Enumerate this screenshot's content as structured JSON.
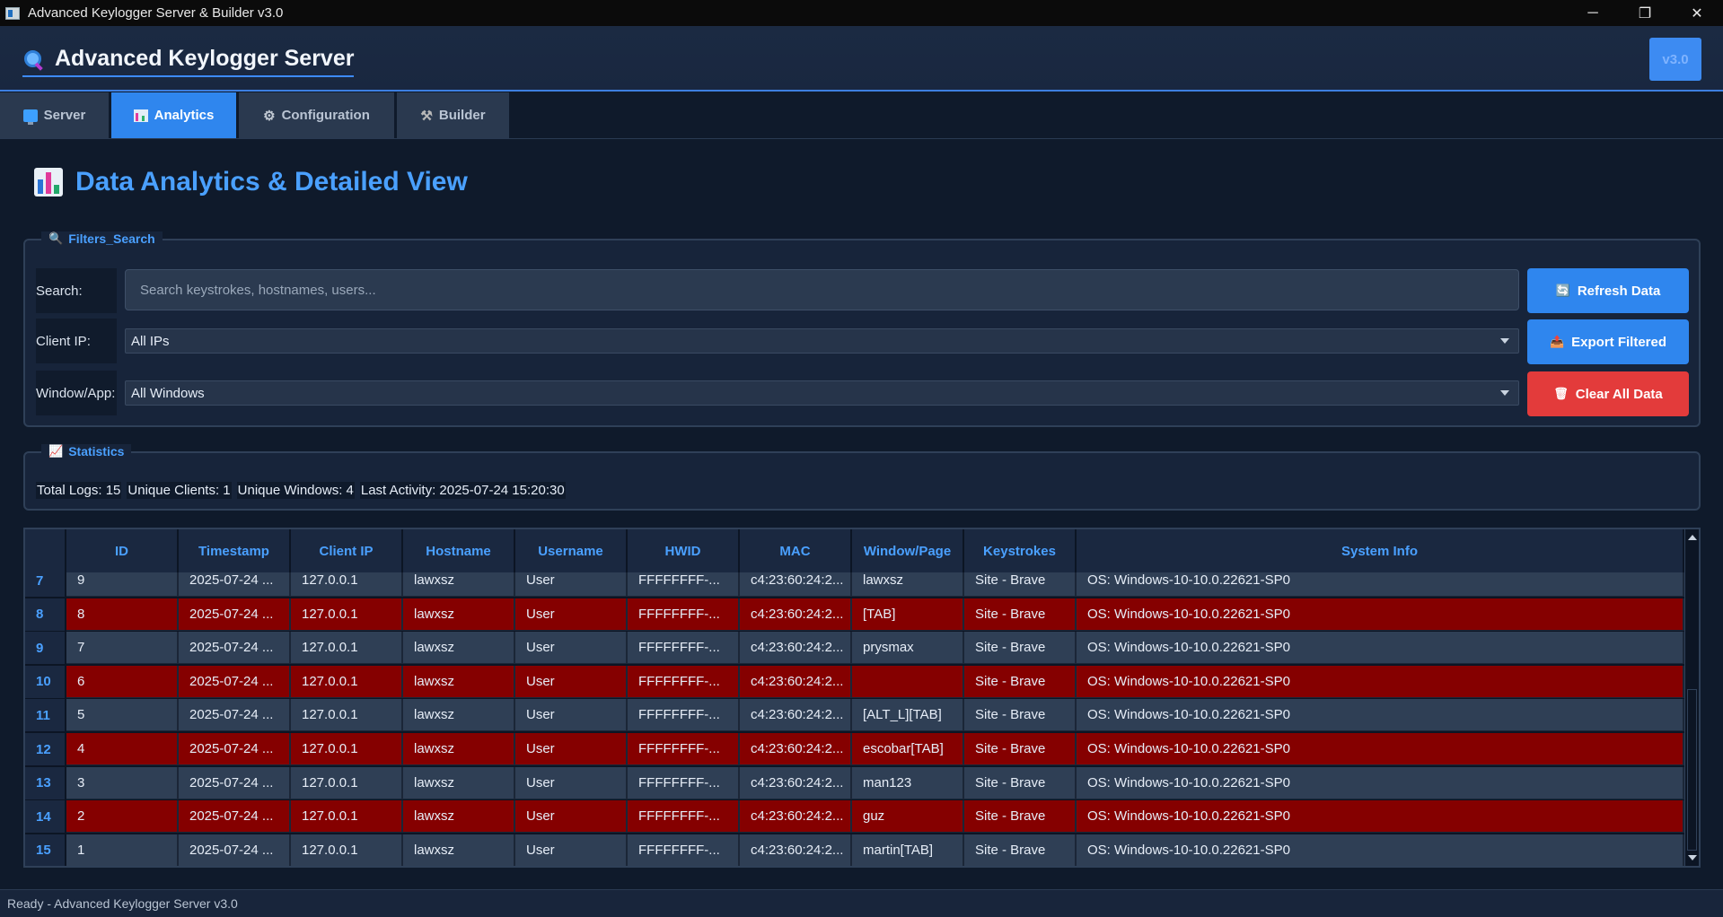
{
  "window": {
    "title": "Advanced Keylogger Server & Builder v3.0",
    "minimize": "─",
    "maximize": "❐",
    "close": "✕"
  },
  "header": {
    "brand": "Advanced Keylogger Server",
    "brand_icon": "magnifier-icon",
    "version_button": "v3.0"
  },
  "tabs": [
    {
      "label": "Server",
      "icon": "monitor-icon",
      "active": false
    },
    {
      "label": "Analytics",
      "icon": "bar-chart-icon",
      "active": true
    },
    {
      "label": "Configuration",
      "icon": "gear-icon",
      "active": false
    },
    {
      "label": "Builder",
      "icon": "hammer-icon",
      "active": false
    }
  ],
  "page_title": "Data Analytics & Detailed View",
  "filters": {
    "group_label": "Filters_Search",
    "search_label": "Search:",
    "search_placeholder": "Search keystrokes, hostnames, users...",
    "search_value": "",
    "client_ip_label": "Client IP:",
    "client_ip_value": "All IPs",
    "window_label": "Window/App:",
    "window_value": "All Windows"
  },
  "actions": {
    "refresh": "Refresh Data",
    "export": "Export Filtered",
    "clear": "Clear All Data",
    "colors": {
      "blue": "#2f86ee",
      "red": "#e33b3b"
    }
  },
  "statistics": {
    "group_label": "Statistics",
    "total_logs": "Total Logs: 15",
    "unique_clients": "Unique Clients: 1",
    "unique_windows": "Unique Windows: 4",
    "last_activity": "Last Activity: 2025-07-24 15:20:30"
  },
  "table": {
    "columns": [
      "ID",
      "Timestamp",
      "Client IP",
      "Hostname",
      "Username",
      "HWID",
      "MAC",
      "Window/Page",
      "Keystrokes",
      "System Info"
    ],
    "rows": [
      {
        "row": "7",
        "cells": [
          "9",
          "2025-07-24 ...",
          "127.0.0.1",
          "lawxsz",
          "User",
          "FFFFFFFF-...",
          "c4:23:60:24:2...",
          "lawxsz",
          "Site - Brave",
          "OS: Windows-10-10.0.22621-SP0"
        ]
      },
      {
        "row": "8",
        "cells": [
          "8",
          "2025-07-24 ...",
          "127.0.0.1",
          "lawxsz",
          "User",
          "FFFFFFFF-...",
          "c4:23:60:24:2...",
          "[TAB]",
          "Site - Brave",
          "OS: Windows-10-10.0.22621-SP0"
        ]
      },
      {
        "row": "9",
        "cells": [
          "7",
          "2025-07-24 ...",
          "127.0.0.1",
          "lawxsz",
          "User",
          "FFFFFFFF-...",
          "c4:23:60:24:2...",
          "prysmax",
          "Site - Brave",
          "OS: Windows-10-10.0.22621-SP0"
        ]
      },
      {
        "row": "10",
        "cells": [
          "6",
          "2025-07-24 ...",
          "127.0.0.1",
          "lawxsz",
          "User",
          "FFFFFFFF-...",
          "c4:23:60:24:2...",
          "",
          "Site - Brave",
          "OS: Windows-10-10.0.22621-SP0"
        ]
      },
      {
        "row": "11",
        "cells": [
          "5",
          "2025-07-24 ...",
          "127.0.0.1",
          "lawxsz",
          "User",
          "FFFFFFFF-...",
          "c4:23:60:24:2...",
          "[ALT_L][TAB]",
          "Site - Brave",
          "OS: Windows-10-10.0.22621-SP0"
        ]
      },
      {
        "row": "12",
        "cells": [
          "4",
          "2025-07-24 ...",
          "127.0.0.1",
          "lawxsz",
          "User",
          "FFFFFFFF-...",
          "c4:23:60:24:2...",
          "escobar[TAB]",
          "Site - Brave",
          "OS: Windows-10-10.0.22621-SP0"
        ]
      },
      {
        "row": "13",
        "cells": [
          "3",
          "2025-07-24 ...",
          "127.0.0.1",
          "lawxsz",
          "User",
          "FFFFFFFF-...",
          "c4:23:60:24:2...",
          "man123",
          "Site - Brave",
          "OS: Windows-10-10.0.22621-SP0"
        ]
      },
      {
        "row": "14",
        "cells": [
          "2",
          "2025-07-24 ...",
          "127.0.0.1",
          "lawxsz",
          "User",
          "FFFFFFFF-...",
          "c4:23:60:24:2...",
          "guz",
          "Site - Brave",
          "OS: Windows-10-10.0.22621-SP0"
        ]
      },
      {
        "row": "15",
        "cells": [
          "1",
          "2025-07-24 ...",
          "127.0.0.1",
          "lawxsz",
          "User",
          "FFFFFFFF-...",
          "c4:23:60:24:2...",
          "martin[TAB]",
          "Site - Brave",
          "OS: Windows-10-10.0.22621-SP0"
        ]
      }
    ],
    "colors": {
      "row_even": "#2f3f55",
      "row_odd": "#850000",
      "header_text": "#4aa0ff"
    }
  },
  "status_bar": "Ready - Advanced Keylogger Server v3.0"
}
